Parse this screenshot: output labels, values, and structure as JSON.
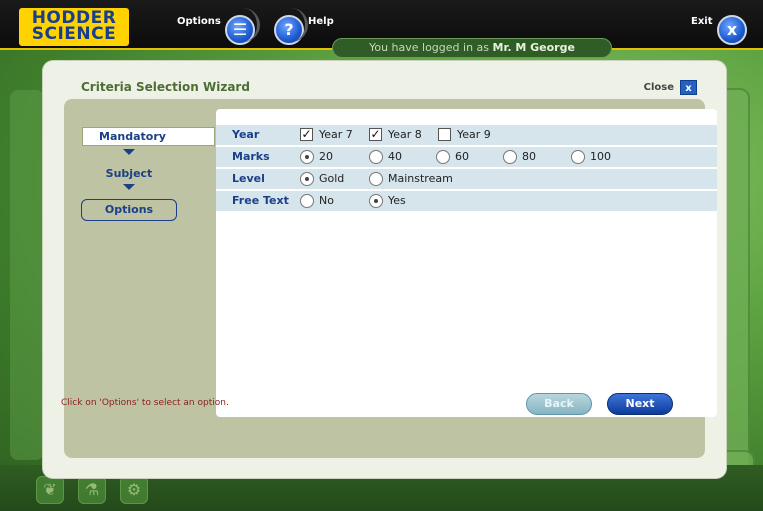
{
  "app": {
    "logo_line1": "HODDER",
    "logo_line2": "SCIENCE",
    "options_label": "Options",
    "help_label": "Help",
    "exit_label": "Exit",
    "login_prefix": "You have logged in as",
    "login_user": "Mr. M George"
  },
  "dialog": {
    "title": "Criteria Selection Wizard",
    "close_label": "Close",
    "close_icon": "x"
  },
  "nav": {
    "mandatory": "Mandatory",
    "subject": "Subject",
    "options": "Options"
  },
  "criteria": {
    "year": {
      "label": "Year",
      "options": [
        {
          "label": "Year 7",
          "checked": true
        },
        {
          "label": "Year 8",
          "checked": true
        },
        {
          "label": "Year 9",
          "checked": false
        }
      ]
    },
    "marks": {
      "label": "Marks",
      "options": [
        "20",
        "40",
        "60",
        "80",
        "100"
      ],
      "selected": "20"
    },
    "level": {
      "label": "Level",
      "options": [
        "Gold",
        "Mainstream"
      ],
      "selected": "Gold"
    },
    "free_text": {
      "label": "Free Text",
      "options": [
        "No",
        "Yes"
      ],
      "selected": "Yes"
    }
  },
  "footer": {
    "hint": "Click on 'Options' to select an option.",
    "back_label": "Back",
    "next_label": "Next"
  },
  "colors": {
    "accent": "#1b3f88",
    "title": "#4c6e35",
    "row": "#d6e4ec",
    "hint": "#8a1e1e"
  }
}
